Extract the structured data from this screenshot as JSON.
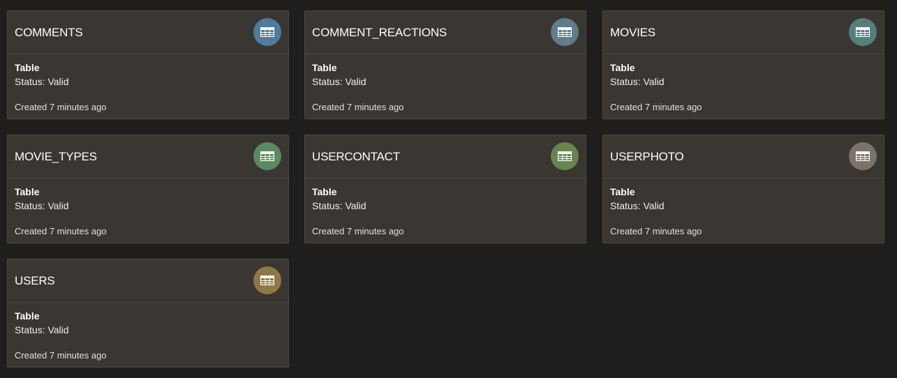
{
  "cards": [
    {
      "name": "COMMENTS",
      "type": "Table",
      "status": "Status: Valid",
      "created": "Created 7 minutes ago",
      "icon": "table-icon",
      "icon_color": "#4e7c9c"
    },
    {
      "name": "COMMENT_REACTIONS",
      "type": "Table",
      "status": "Status: Valid",
      "created": "Created 7 minutes ago",
      "icon": "table-icon",
      "icon_color": "#5f7d8a"
    },
    {
      "name": "MOVIES",
      "type": "Table",
      "status": "Status: Valid",
      "created": "Created 7 minutes ago",
      "icon": "table-icon",
      "icon_color": "#557f7a"
    },
    {
      "name": "MOVIE_TYPES",
      "type": "Table",
      "status": "Status: Valid",
      "created": "Created 7 minutes ago",
      "icon": "table-icon",
      "icon_color": "#5a8a5e"
    },
    {
      "name": "USERCONTACT",
      "type": "Table",
      "status": "Status: Valid",
      "created": "Created 7 minutes ago",
      "icon": "table-icon",
      "icon_color": "#66854f"
    },
    {
      "name": "USERPHOTO",
      "type": "Table",
      "status": "Status: Valid",
      "created": "Created 7 minutes ago",
      "icon": "table-icon",
      "icon_color": "#7a7466"
    },
    {
      "name": "USERS",
      "type": "Table",
      "status": "Status: Valid",
      "created": "Created 7 minutes ago",
      "icon": "table-icon",
      "icon_color": "#8c7945"
    }
  ]
}
